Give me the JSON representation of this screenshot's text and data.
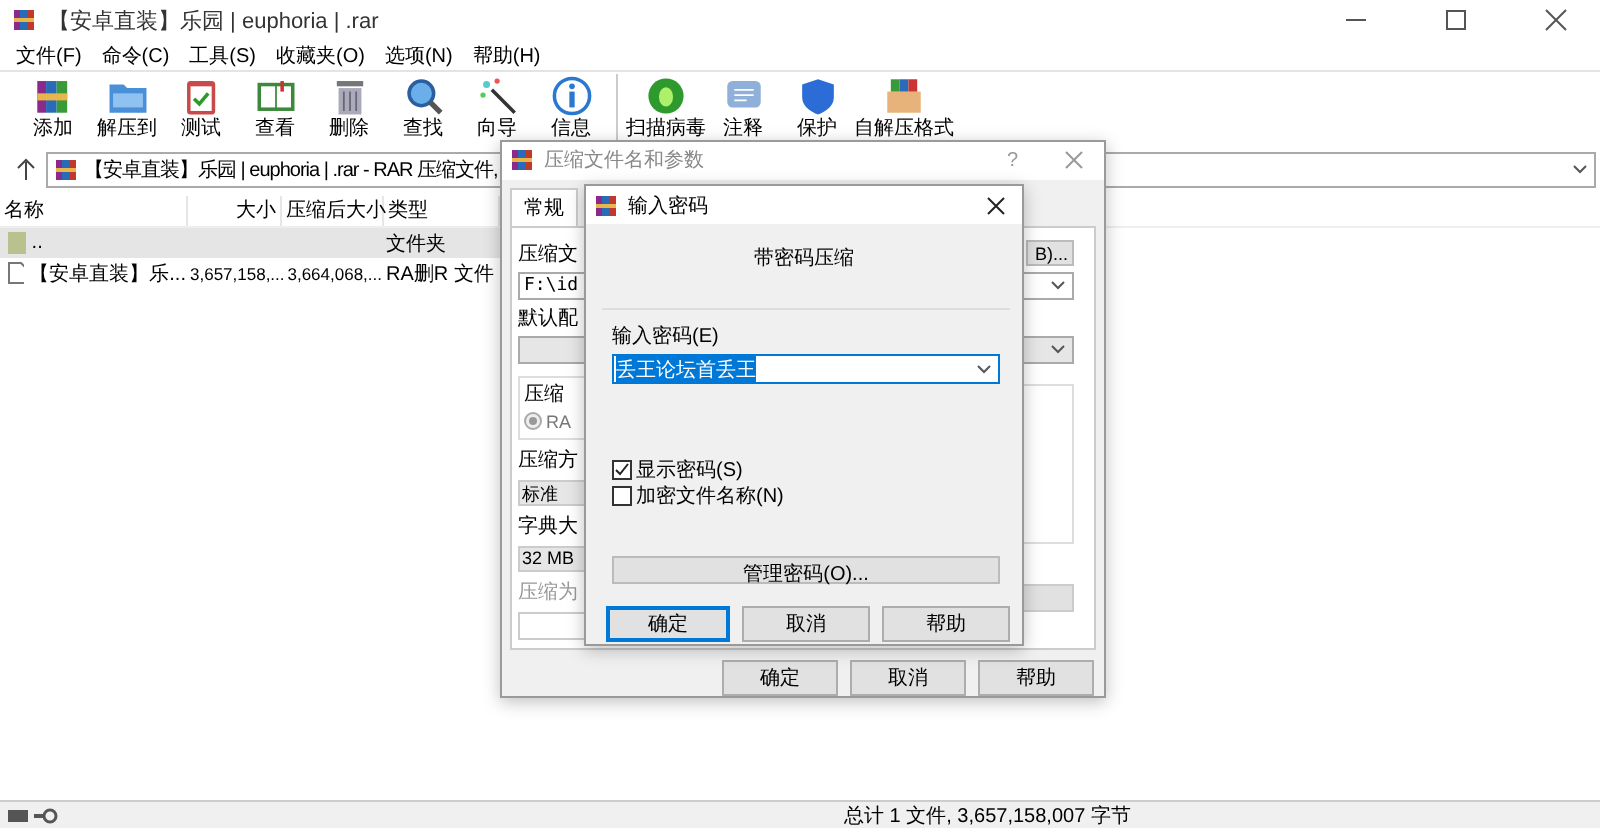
{
  "window": {
    "title": "【安卓直装】乐园 | euphoria | .rar"
  },
  "menu": [
    "文件(F)",
    "命令(C)",
    "工具(S)",
    "收藏夹(O)",
    "选项(N)",
    "帮助(H)"
  ],
  "toolbar": [
    {
      "label": "添加"
    },
    {
      "label": "解压到"
    },
    {
      "label": "测试"
    },
    {
      "label": "查看"
    },
    {
      "label": "删除"
    },
    {
      "label": "查找"
    },
    {
      "label": "向导"
    },
    {
      "label": "信息"
    },
    {
      "label": "扫描病毒"
    },
    {
      "label": "注释"
    },
    {
      "label": "保护"
    },
    {
      "label": "自解压格式"
    }
  ],
  "address": {
    "path": "【安卓直装】乐园 | euphoria | .rar - RAR 压缩文件,"
  },
  "columns": [
    "名称",
    "大小",
    "压缩后大小",
    "类型"
  ],
  "rows": [
    {
      "kind": "folder",
      "name": "..",
      "type": "文件夹",
      "selected": true
    },
    {
      "kind": "file",
      "name": "【安卓直装】乐...",
      "size": "3,657,158,...",
      "packed": "3,664,068,...",
      "type": "RA删R 文件",
      "selected": false
    }
  ],
  "status_bar": {
    "text": "总计 1 文件, 3,657,158,007 字节"
  },
  "archive_dialog": {
    "title": "压缩文件名和参数",
    "help": "?",
    "tabs": [
      {
        "label": "常规",
        "selected": true
      }
    ],
    "archive_label": "压缩文",
    "browse_button": "B)...",
    "archive_name": "F:\\id",
    "profile_label": "默认配",
    "format_group": "压缩",
    "format_option": {
      "label": "RA",
      "selected": true
    },
    "method_label": "压缩方",
    "method": "标准",
    "dict_label": "字典大",
    "dict": "32 MB",
    "split_label": "压缩为",
    "buttons": [
      "确定",
      "取消",
      "帮助"
    ]
  },
  "password_dialog": {
    "title": "输入密码",
    "heading": "带密码压缩",
    "password_label": "输入密码(E)",
    "password": "丢王论坛首丢王",
    "checks": [
      {
        "label": "显示密码(S)",
        "checked": true
      },
      {
        "label": "加密文件名称(N)",
        "checked": false
      }
    ],
    "manage_button": "管理密码(O)...",
    "buttons": [
      {
        "label": "确定",
        "default": true
      },
      {
        "label": "取消",
        "default": false
      },
      {
        "label": "帮助",
        "default": false
      }
    ]
  }
}
